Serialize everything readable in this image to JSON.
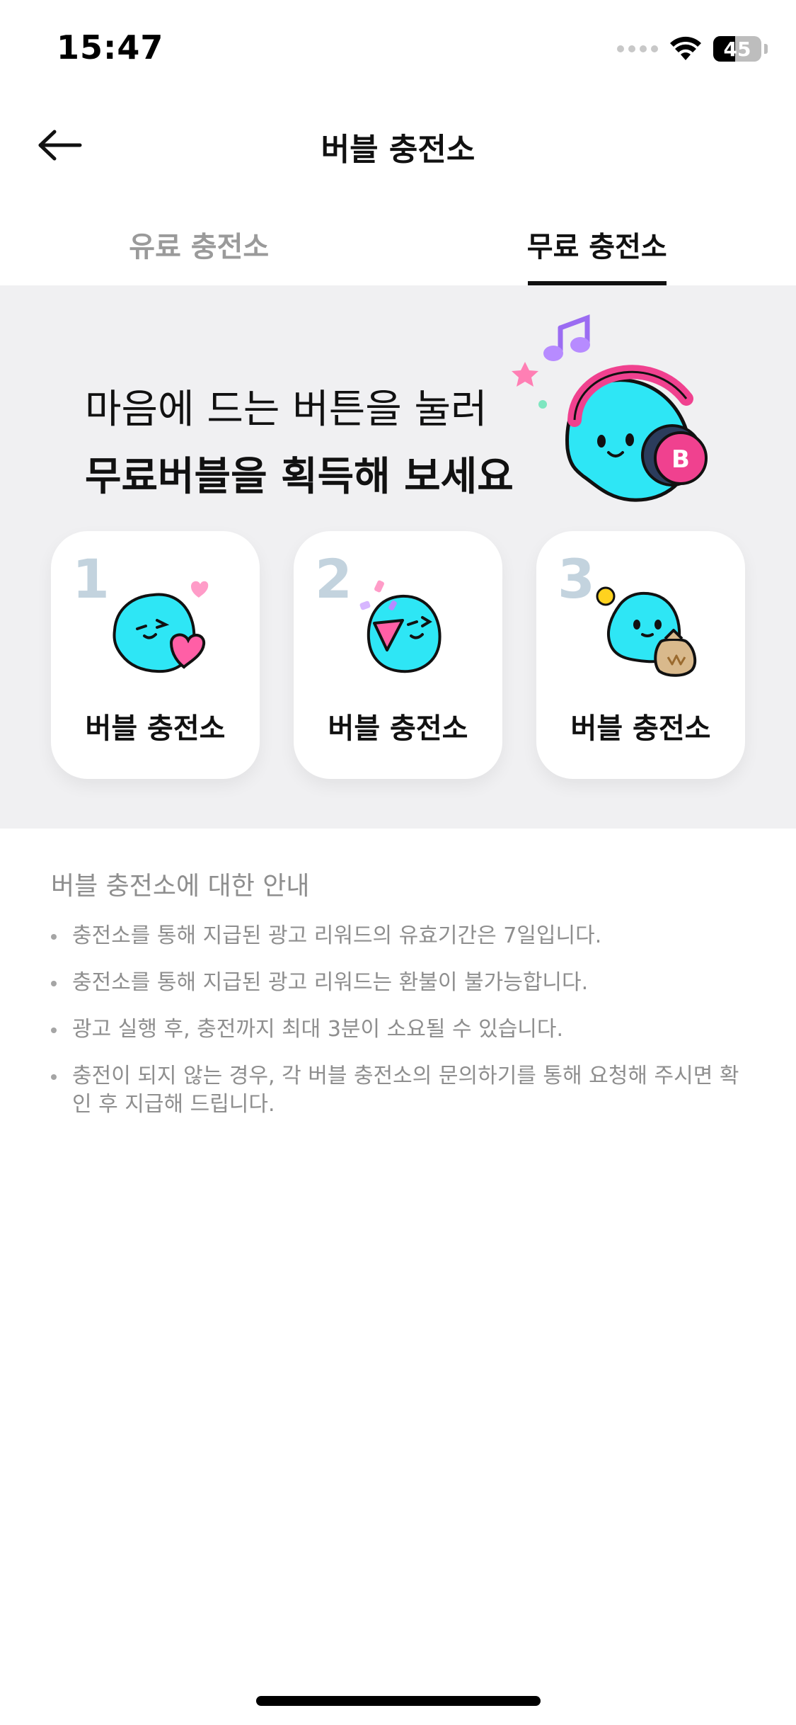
{
  "status_bar": {
    "time": "15:47",
    "battery": "45",
    "battery_fraction": 0.45,
    "icons": [
      "cellular-signal-icon",
      "wifi-icon",
      "battery-icon"
    ]
  },
  "header": {
    "title": "버블 충전소",
    "back_icon": "arrow-left-icon"
  },
  "tabs": [
    {
      "label": "유료 충전소",
      "active": false
    },
    {
      "label": "무료 충전소",
      "active": true
    }
  ],
  "promo": {
    "line1": "마음에 드는 버튼을 눌러",
    "line2": "무료버블을 획득해 보세요",
    "mascot_badge": "B"
  },
  "cards": [
    {
      "number": "1",
      "label": "버블 충전소",
      "icon": "mascot-heart-icon"
    },
    {
      "number": "2",
      "label": "버블 충전소",
      "icon": "mascot-party-popper-icon"
    },
    {
      "number": "3",
      "label": "버블 충전소",
      "icon": "mascot-money-bag-icon"
    }
  ],
  "info": {
    "title": "버블 충전소에 대한 안내",
    "items": [
      "충전소를 통해 지급된 광고 리워드의 유효기간은 7일입니다.",
      "충전소를 통해 지급된 광고 리워드는 환불이 불가능합니다.",
      "광고 실행 후, 충전까지 최대 3분이 소요될 수 있습니다.",
      "충전이 되지 않는 경우, 각 버블 충전소의 문의하기를 통해 요청해 주시면 확인 후 지급해 드립니다."
    ]
  },
  "colors": {
    "mascot": "#2ee6f5",
    "headphones": "#f0418f",
    "number": "#c3d3de",
    "promo_bg": "#f0f0f2"
  }
}
